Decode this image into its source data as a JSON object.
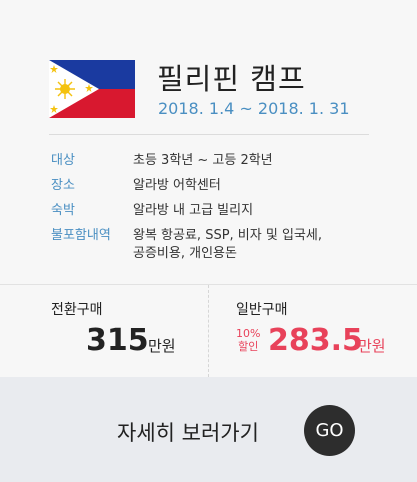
{
  "camp": {
    "title": "필리핀 캠프",
    "dates": "2018. 1.4  ~ 2018. 1. 31",
    "flag_icon": "philippines-flag-icon"
  },
  "info": [
    {
      "label": "대상",
      "value": "초등 3학년 ~ 고등 2학년"
    },
    {
      "label": "장소",
      "value": "알라방 어학센터"
    },
    {
      "label": "숙박",
      "value": "알라방 내 고급 빌리지"
    },
    {
      "label": "불포함내역",
      "value": "왕복 항공료, SSP, 비자 및 입국세,\n공증비용, 개인용돈"
    }
  ],
  "pricing": {
    "transfer_label": "전환구매",
    "transfer_price": "315",
    "transfer_unit": "만원",
    "general_label": "일반구매",
    "discount_line1": "10%",
    "discount_line2": "할인",
    "general_price": "283.5",
    "general_unit": "만원"
  },
  "cta": {
    "text": "자세히 보러가기",
    "button": "GO"
  },
  "colors": {
    "accent_blue": "#4a8fc2",
    "sale_red": "#e8425a",
    "button_dark": "#2d2d2d"
  }
}
